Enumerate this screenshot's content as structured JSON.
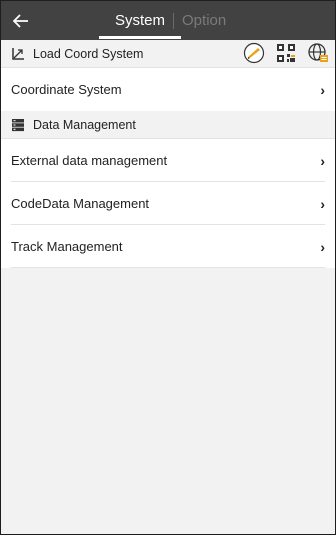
{
  "header": {
    "tabs": [
      {
        "label": "System",
        "active": true
      },
      {
        "label": "Option",
        "active": false
      }
    ]
  },
  "load_coord": {
    "label": "Load Coord System",
    "tools": [
      "map-pen-icon",
      "qr-code-icon",
      "globe-settings-icon"
    ]
  },
  "coordinate_system": {
    "label": "Coordinate System"
  },
  "data_management": {
    "label": "Data Management",
    "items": [
      {
        "label": "External data management"
      },
      {
        "label": "CodeData Management"
      },
      {
        "label": "Track Management"
      }
    ]
  },
  "colors": {
    "header_bg": "#424242",
    "accent": "#e8a21b"
  }
}
